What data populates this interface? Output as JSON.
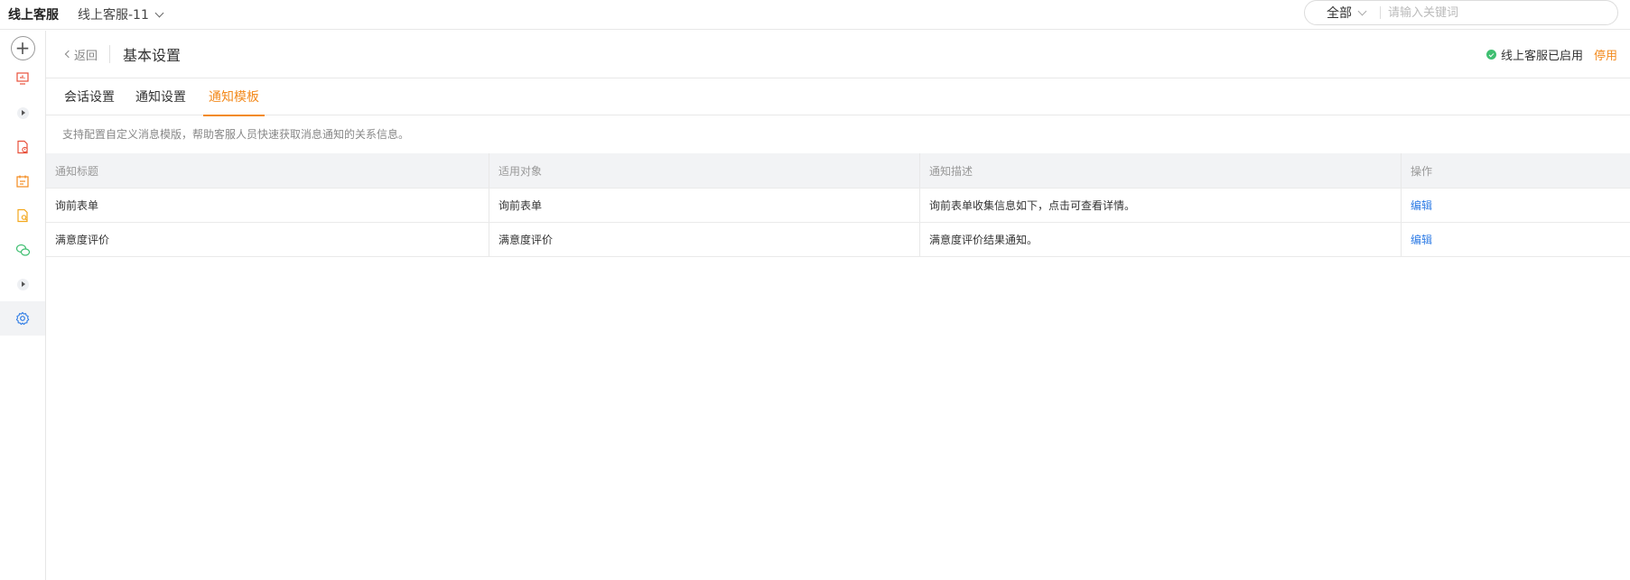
{
  "topbar": {
    "app_title": "线上客服",
    "channel": "线上客服-11",
    "search": {
      "scope": "全部",
      "placeholder": "请输入关键词",
      "value": ""
    }
  },
  "sidebar": {
    "items": [
      {
        "icon": "plus-icon"
      },
      {
        "icon": "monitor-chart-icon",
        "color": "#e8513b"
      },
      {
        "icon": "expand-arrow-icon"
      },
      {
        "icon": "document-alert-icon",
        "color": "#e8513b"
      },
      {
        "icon": "calendar-icon",
        "color": "#f38a1d"
      },
      {
        "icon": "document-search-icon",
        "color": "#f3a81d"
      },
      {
        "icon": "wechat-icon",
        "color": "#3fbf71"
      },
      {
        "icon": "expand-arrow-icon"
      },
      {
        "icon": "gear-icon",
        "color": "#2d7be5",
        "active": true
      }
    ]
  },
  "header": {
    "back_label": "返回",
    "title": "基本设置",
    "status_text": "线上客服已启用",
    "disable_label": "停用"
  },
  "tabs": [
    {
      "label": "会话设置",
      "active": false
    },
    {
      "label": "通知设置",
      "active": false
    },
    {
      "label": "通知模板",
      "active": true
    }
  ],
  "hint": "支持配置自定义消息模版，帮助客服人员快速获取消息通知的关系信息。",
  "table": {
    "columns": [
      "通知标题",
      "适用对象",
      "通知描述",
      "操作"
    ],
    "rows": [
      {
        "title": "询前表单",
        "target": "询前表单",
        "description": "询前表单收集信息如下，点击可查看详情。",
        "action": "编辑"
      },
      {
        "title": "满意度评价",
        "target": "满意度评价",
        "description": "满意度评价结果通知。",
        "action": "编辑"
      }
    ]
  },
  "colors": {
    "accent": "#f38a1d",
    "link": "#2d7be5",
    "success": "#3fbf71"
  }
}
